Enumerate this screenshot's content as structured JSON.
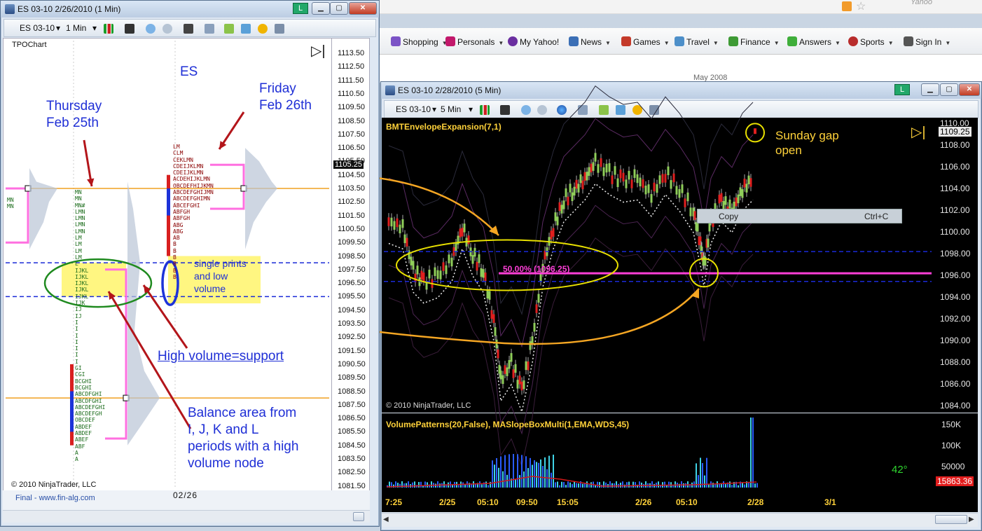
{
  "browser": {
    "toolbar_items": [
      "Shopping",
      "Personals",
      "My Yahoo!",
      "News",
      "Games",
      "Travel",
      "Finance",
      "Answers",
      "Sports",
      "Sign In"
    ],
    "calendar_label": "May 2008",
    "yahoo_label": "Yahoo"
  },
  "left_window": {
    "title": "ES 03-10  2/26/2010 (1 Min)",
    "l_button": "L",
    "instrument": "ES 03-10",
    "interval": "1 Min",
    "chart_name": "TPOChart",
    "copyright": "© 2010 NinjaTrader, LLC",
    "footer_link": "Final - www.fin-alg.com",
    "date_label": "02/26",
    "price_marker": "1105.25",
    "price_axis": [
      "1113.50",
      "1112.50",
      "1111.50",
      "1110.50",
      "1109.50",
      "1108.50",
      "1107.50",
      "1106.50",
      "1105.50",
      "1104.50",
      "1103.50",
      "1102.50",
      "1101.50",
      "1100.50",
      "1099.50",
      "1098.50",
      "1097.50",
      "1096.50",
      "1095.50",
      "1094.50",
      "1093.50",
      "1092.50",
      "1091.50",
      "1090.50",
      "1089.50",
      "1088.50",
      "1087.50",
      "1086.50",
      "1085.50",
      "1084.50",
      "1083.50",
      "1082.50",
      "1081.50"
    ],
    "annotations": {
      "es": "ES",
      "thursday": "Thursday\nFeb 25th",
      "friday": "Friday\nFeb 26th",
      "single_prints": "single prints\nand low\nvolume",
      "high_volume": "High volume=support",
      "balance": "Balance area from\nI, J, K and L\nperiods with a high\nvolume node"
    },
    "tpo_thursday": "MN\nMN\nMN#\nLMN\nLMN\nLMN\nLMN\nLM\nLM\nLM\nLM\nL\nIJKL\nIJKL\nIJKL\nIJKL\nIJKL\nIJK\nIJ\nIJ\nI\nI\nI\nI\nI\nI\nI\nGI\nCGI\nBCGHI\nBCGHI\nABCDFGHI\nABCDFGHI\nABCDEFGHI\nABCDEFGH\nOBCDEF\nABDEF\nABDEF\nABEF\nABF\nA\nA",
    "tpo_friday": "LM\nCLM\nCEKLMN\nCDEIJKLMN\nCDEIJKLMN\nACDEHIJKLMN\nOBCDEFHIJKMN\nABCDEFGHIJMN\nABCDEFGHIMN\nABCEFGHI\nABFGH\nABFGH\nABG\nABG\nAB\nB\nB\nB\nB\nB\nB",
    "tpo_prev": "MN\nMN"
  },
  "right_window": {
    "title": "ES 03-10  2/28/2010 (5 Min)",
    "l_button": "L",
    "instrument": "ES 03-10",
    "interval": "5 Min",
    "indicator_top": "BMTEnvelopeExpansion(7,1)",
    "indicator_bottom": "VolumePatterns(20,False), MASlopeBoxMulti(1,EMA,WDS,45)",
    "copyright": "© 2010 NinjaTrader, LLC",
    "price_marker": "1109.25",
    "price_axis": [
      "1110.00",
      "1108.00",
      "1106.00",
      "1104.00",
      "1102.00",
      "1100.00",
      "1098.00",
      "1096.00",
      "1094.00",
      "1092.00",
      "1090.00",
      "1088.00",
      "1086.00",
      "1084.00"
    ],
    "volume_axis": [
      "150K",
      "100K",
      "50000"
    ],
    "volume_marker": "15863.36",
    "time_axis": [
      "7:25",
      "2/25",
      "05:10",
      "09:50",
      "15:05",
      "2/26",
      "05:10",
      "2/28",
      "3/1"
    ],
    "fib_label": "50.00% (1096.25)",
    "angle_label": "42°",
    "sunday_gap": "Sunday gap\nopen",
    "copy_item": "Copy",
    "copy_shortcut": "Ctrl+C"
  },
  "colors": {
    "annotation_blue": "#1f2fd6",
    "annotation_yellow": "#ffd23a",
    "arrow_orange": "#f5a623",
    "arrow_red": "#b3151a",
    "magenta": "#ff3fd8",
    "level_blue": "#1a2ad8",
    "highlight_yellow": "#fff56b"
  }
}
